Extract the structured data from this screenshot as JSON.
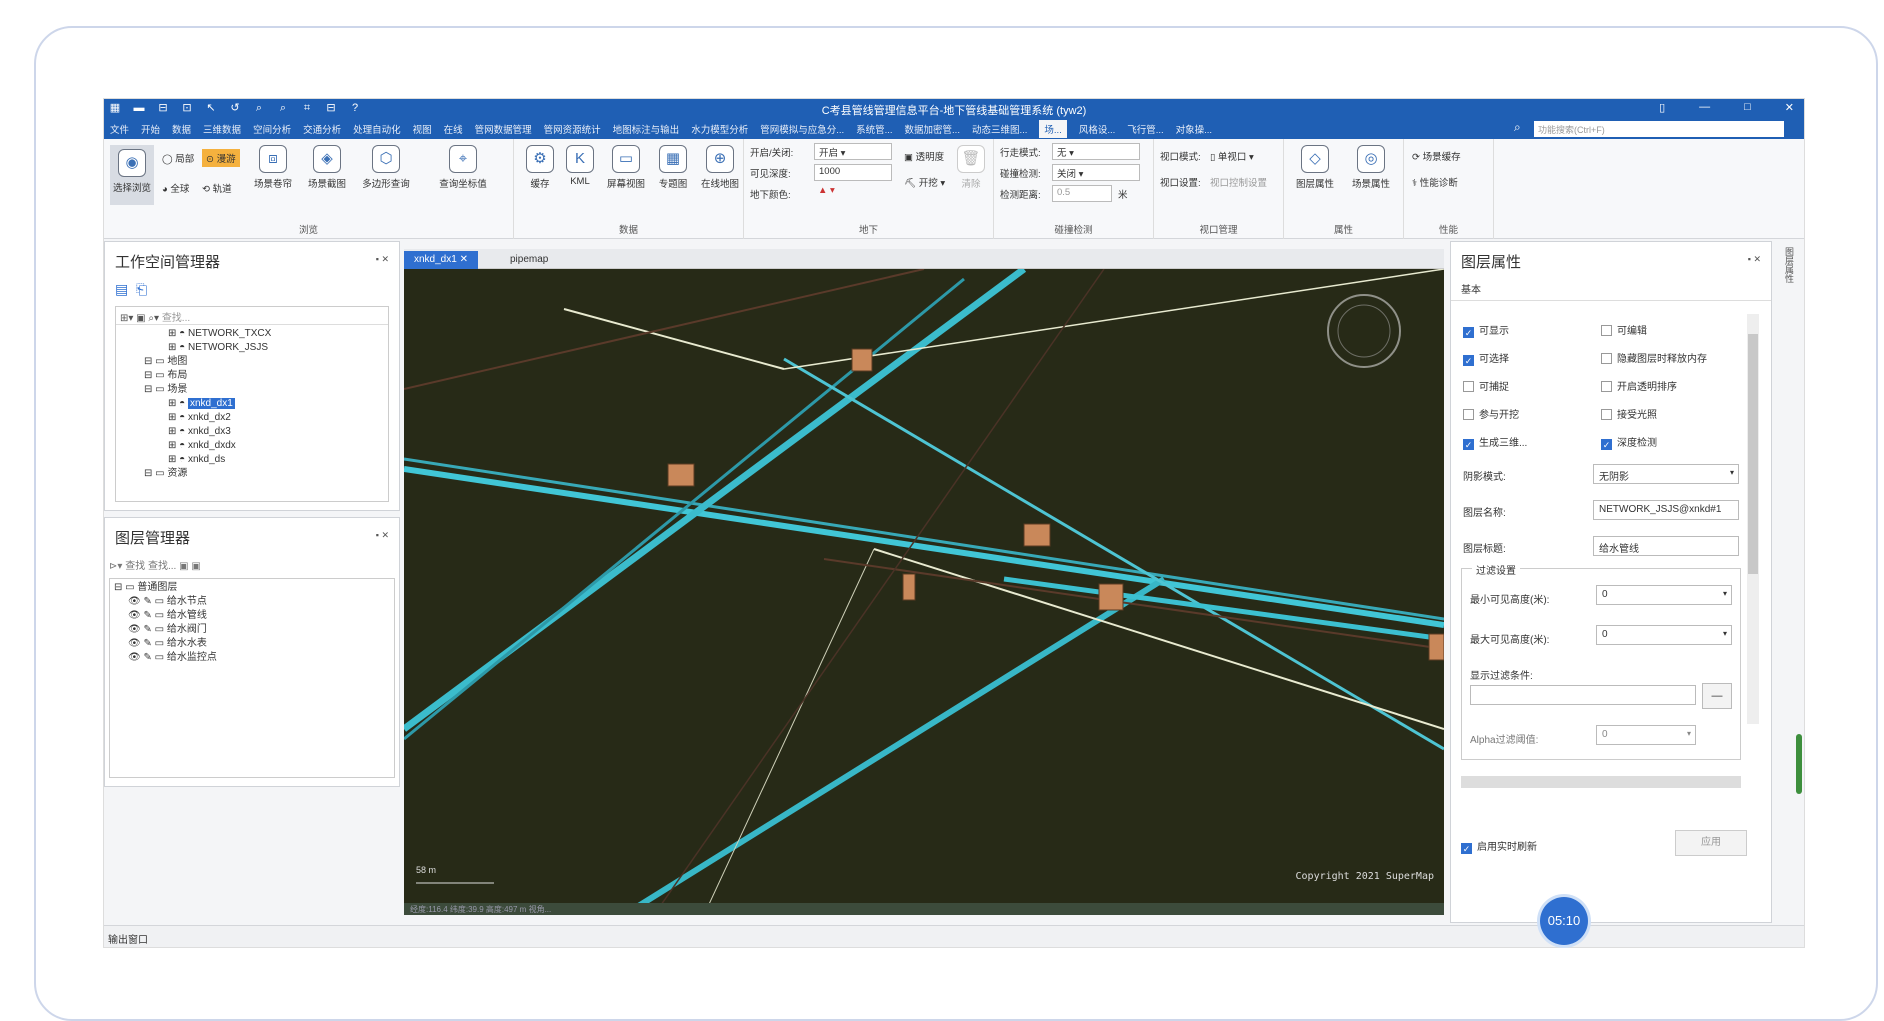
{
  "window": {
    "title": "C考县管线管理信息平台-地下管线基础管理系统 (tyw2)",
    "quick_access": [
      "▦",
      "▬",
      "⊟",
      "⊡",
      "↖",
      "↺",
      "⌕",
      "⌕",
      "⌗",
      "⊟",
      "?"
    ],
    "controls": [
      "▯",
      "—",
      "□",
      "✕"
    ]
  },
  "menu": {
    "items": [
      "文件",
      "开始",
      "数据",
      "三维数据",
      "空间分析",
      "交通分析",
      "处理自动化",
      "视图",
      "在线",
      "管网数据管理",
      "管网资源统计",
      "地图标注与输出",
      "水力模型分析",
      "管网模拟与应急分...",
      "系统管...",
      "数据加密管...",
      "动态三维图...",
      "场...",
      "风格设...",
      "飞行管...",
      "对象操..."
    ],
    "active_index": 17,
    "search_placeholder": "功能搜索(Ctrl+F)"
  },
  "ribbon": {
    "browse": {
      "label": "浏览",
      "select_label": "选择浏览",
      "local": "局部",
      "walk": "漫游",
      "globe": "全球",
      "track": "轨道",
      "roll": "场景卷帘",
      "snapshot": "场景截图",
      "polyquery": "多边形查询",
      "coords": "查询坐标值"
    },
    "data": {
      "label": "数据",
      "cache": "缓存",
      "kml": "KML",
      "screen": "屏幕视图",
      "theme": "专题图",
      "online": "在线地图"
    },
    "underground": {
      "label": "地下",
      "open_close_label": "开启/关闭:",
      "open_close_value": "开启",
      "depth_label": "可见深度:",
      "depth_value": "1000",
      "color_label": "地下颜色:",
      "transparency": "透明度",
      "excavate": "开挖",
      "clear": "清除"
    },
    "collision": {
      "label": "碰撞检测",
      "line_mode_label": "行走模式:",
      "line_mode_value": "无",
      "collide_label": "碰撞检测:",
      "collide_value": "关闭",
      "distance_label": "检测距离:",
      "distance_value": "0.5",
      "unit": "米"
    },
    "viewport": {
      "label": "视口管理",
      "mode_label": "视口模式:",
      "mode_value": "单视口",
      "setting_label": "视口设置:",
      "setting_value": "视口控制设置"
    },
    "attributes": {
      "label": "属性",
      "layer": "图层属性",
      "scene": "场景属性"
    },
    "performance": {
      "label": "性能",
      "cache": "场景缓存",
      "diagnose": "性能诊断"
    }
  },
  "workspace": {
    "title": "工作空间管理器",
    "search_placeholder": "查找...",
    "tree": [
      {
        "label": "NETWORK_TXCX",
        "indent": 4
      },
      {
        "label": "NETWORK_JSJS",
        "indent": 4
      },
      {
        "label": "地图",
        "indent": 2
      },
      {
        "label": "布局",
        "indent": 2
      },
      {
        "label": "场景",
        "indent": 2
      },
      {
        "label": "xnkd_dx1",
        "indent": 4,
        "selected": true
      },
      {
        "label": "xnkd_dx2",
        "indent": 4
      },
      {
        "label": "xnkd_dx3",
        "indent": 4
      },
      {
        "label": "xnkd_dxdx",
        "indent": 4
      },
      {
        "label": "xnkd_ds",
        "indent": 4
      },
      {
        "label": "资源",
        "indent": 2
      }
    ]
  },
  "layers": {
    "title": "图层管理器",
    "search_placeholder": "查找 查找...",
    "group": "普通图层",
    "items": [
      "给水节点",
      "给水管线",
      "给水阀门",
      "给水水表",
      "给水监控点"
    ]
  },
  "doc_tabs": [
    "xnkd_dx1",
    "pipemap"
  ],
  "scene": {
    "scale": "58 m",
    "copyright": "Copyright 2021 SuperMap",
    "status_bar": "经度:116.4 纬度:39.9 高度:497 m 视角..."
  },
  "layer_props": {
    "title": "图层属性",
    "tab": "基本",
    "checks": [
      {
        "label": "可显示",
        "on": true
      },
      {
        "label": "可编辑",
        "on": false
      },
      {
        "label": "可选择",
        "on": true
      },
      {
        "label": "隐藏图层时释放内存",
        "on": false
      },
      {
        "label": "可捕捉",
        "on": false
      },
      {
        "label": "开启透明排序",
        "on": false
      },
      {
        "label": "参与开挖",
        "on": false
      },
      {
        "label": "接受光照",
        "on": false
      },
      {
        "label": "生成三维...",
        "on": true
      },
      {
        "label": "深度检测",
        "on": true
      }
    ],
    "shadow_label": "阴影模式:",
    "shadow_value": "无阴影",
    "name_label": "图层名称:",
    "name_value": "NETWORK_JSJS@xnkd#1",
    "caption_label": "图层标题:",
    "caption_value": "给水管线",
    "filter_group": "过滤设置",
    "min_label": "最小可见高度(米):",
    "min_value": "0",
    "max_label": "最大可见高度(米):",
    "max_value": "0",
    "filter_label": "显示过滤条件:",
    "alpha_label": "Alpha过滤阈值:",
    "alpha_value": "0",
    "realtime_label": "启用实时刷新",
    "apply_label": "应用"
  },
  "statusbar": {
    "output": "输出窗口"
  },
  "timer": "05:10",
  "side_strip": "图层属性"
}
